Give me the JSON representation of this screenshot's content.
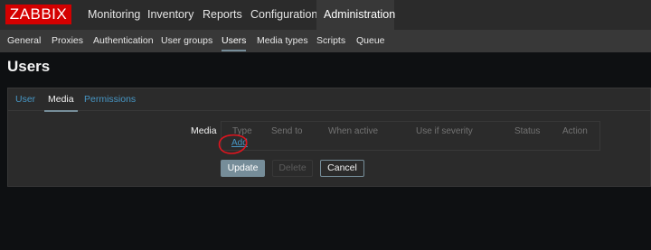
{
  "logo": "ZABBIX",
  "top_menu": [
    "Monitoring",
    "Inventory",
    "Reports",
    "Configuration",
    "Administration"
  ],
  "sub_menu": [
    "General",
    "Proxies",
    "Authentication",
    "User groups",
    "Users",
    "Media types",
    "Scripts",
    "Queue"
  ],
  "page_title": "Users",
  "tabs": [
    "User",
    "Media",
    "Permissions"
  ],
  "media": {
    "label": "Media",
    "columns": [
      "Type",
      "Send to",
      "When active",
      "Use if severity",
      "Status",
      "Action"
    ],
    "add_link": "Add"
  },
  "buttons": {
    "update": "Update",
    "delete": "Delete",
    "cancel": "Cancel"
  },
  "colors": {
    "logo": "#d40000",
    "link": "#4796c4",
    "annotation": "#e0141e",
    "accent": "#768d99"
  }
}
